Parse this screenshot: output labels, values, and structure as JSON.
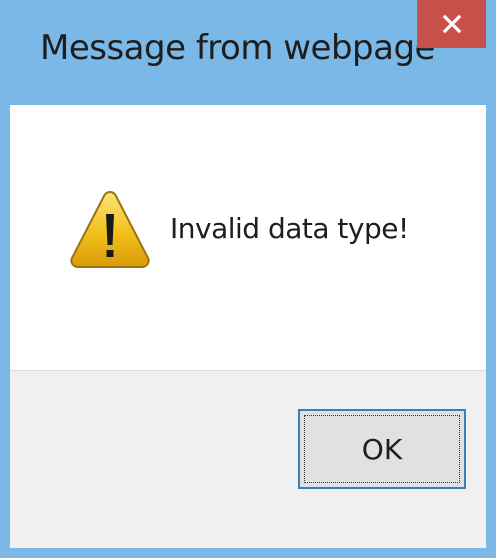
{
  "window": {
    "title": "Message from webpage",
    "close_icon": "close-icon"
  },
  "dialog": {
    "icon": "warning-icon",
    "message": "Invalid data type!",
    "ok_label": "OK"
  },
  "colors": {
    "frame": "#7ab8e8",
    "close_button": "#c7504a",
    "button_area": "#f0f0f0",
    "button_border": "#3c7fb1",
    "warning_fill": "#f2c01a"
  }
}
